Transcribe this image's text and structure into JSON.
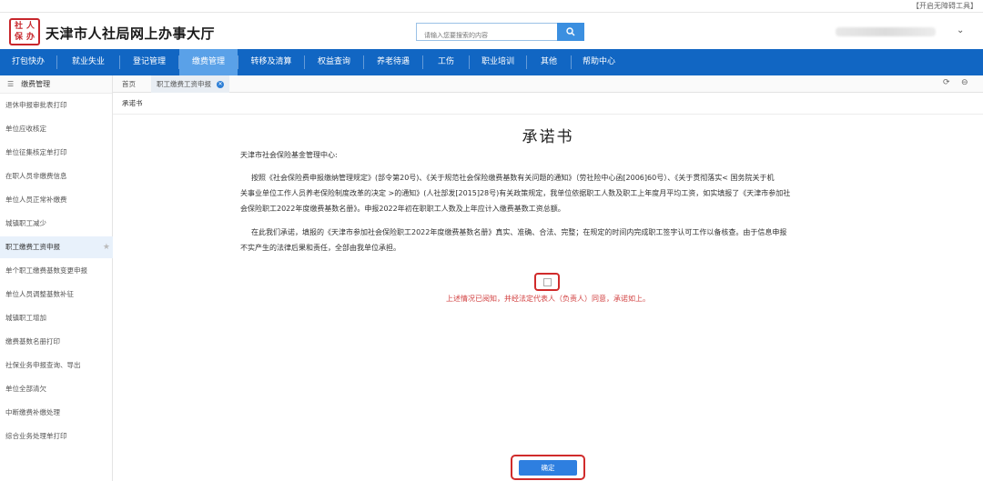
{
  "topbar": {
    "accessibility_link": "【开启无障碍工具】"
  },
  "header": {
    "logo_chars": [
      "社",
      "人",
      "保",
      "办"
    ],
    "site_title": "天津市人社局网上办事大厅",
    "search_placeholder": "请输入您要搜索的内容"
  },
  "nav": {
    "items": [
      "打包快办",
      "就业失业",
      "登记管理",
      "缴费管理",
      "转移及清算",
      "权益查询",
      "养老待遇",
      "工伤",
      "职业培训",
      "其他",
      "帮助中心"
    ],
    "active": "缴费管理"
  },
  "sidebar": {
    "heading": "缴费管理",
    "items": [
      "退休申报审批表打印",
      "单位应收核定",
      "单位征集核定单打印",
      "在职人员非缴费信息",
      "单位人员正常补缴费",
      "城镇职工减少",
      "职工缴费工资申报",
      "单个职工缴费基数变更申报",
      "单位人员调整基数补征",
      "城镇职工增加",
      "缴费基数名册打印",
      "社保业务申报查询、导出",
      "单位全部清欠",
      "中断缴费补缴处理",
      "综合业务处理单打印"
    ],
    "active_index": 6
  },
  "tabs": {
    "home": "首页",
    "current": "职工缴费工资申报"
  },
  "subheader": "承诺书",
  "document": {
    "title": "承诺书",
    "addressee": "天津市社会保险基金管理中心:",
    "para1_line1": "按照《社会保险费申报缴纳管理规定》(部令第20号)、《关于规范社会保险缴费基数有关问题的通知》（劳社险中心函[2006]60号）、《关于贯彻落实< 国务院关于机",
    "para1_line2": "关事业单位工作人员养老保险制度改革的决定 >的通知》(人社部发[2015]28号)有关政策规定，我单位依据职工人数及职工上年度月平均工资，如实填报了《天津市参加社",
    "para1_line3": "会保险职工2022年度缴费基数名册》。申报2022年初在职职工人数及上年应计入缴费基数工资总额。",
    "para2_line1": "在此我们承诺，填报的《天津市参加社会保险职工2022年度缴费基数名册》真实、准确、合法、完整；在规定的时间内完成职工签字认可工作以备核查。由于信息申报",
    "para2_line2": "不实产生的法律后果和责任，全部由我单位承担。",
    "agreement_text": "上述情况已阅知，并经法定代表人（负责人）同意，承诺如上。",
    "confirm_label": "确定"
  }
}
